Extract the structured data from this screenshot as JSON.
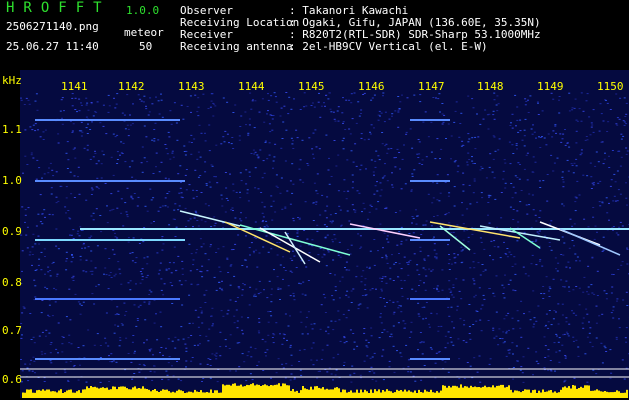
{
  "header": {
    "app_name": "HROFFT",
    "app_version": "1.0.0",
    "filename": "2506271140.png",
    "mode_label": "meteor",
    "datetime": "25.06.27 11:40",
    "count": "50",
    "info_labels": [
      "Observer",
      "Receiving Location",
      "Receiver",
      "Receiving antenna"
    ],
    "info_values": [
      ": Takanori Kawachi",
      ": Ogaki, Gifu, JAPAN (136.60E, 35.35N)",
      ": R820T2(RTL-SDR) SDR-Sharp 53.1000MHz",
      ": 2el-HB9CV Vertical (el. E-W)"
    ]
  },
  "axis": {
    "unit_label": "kHz",
    "time_ticks": [
      "1141",
      "1142",
      "1143",
      "1144",
      "1145",
      "1146",
      "1147",
      "1148",
      "1149",
      "1150"
    ],
    "freq_ticks": [
      "1.1",
      "1.0",
      "0.9",
      "0.8",
      "0.7",
      "0.6"
    ]
  },
  "colors": {
    "background": "#000000",
    "text": "#ffffff",
    "accent_green": "#2ee02e",
    "axis_yellow": "#ffff00",
    "noise_blue": "#1c2aa0",
    "level_bar": "#ffe600"
  }
}
